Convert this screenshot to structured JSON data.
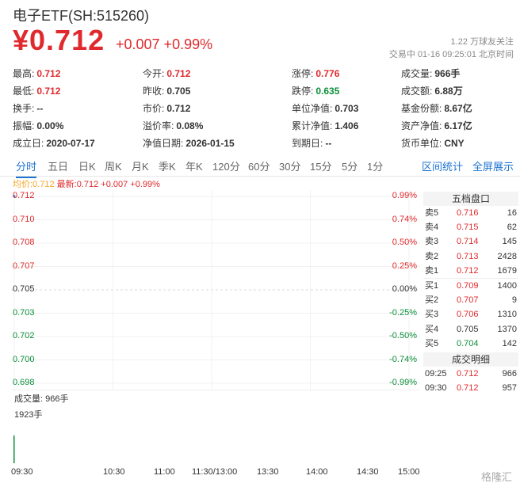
{
  "header": {
    "title": "电子ETF(SH:515260)",
    "price": "¥0.712",
    "change": "+0.007 +0.99%",
    "follow": "1.22 万球友关注",
    "status_time": "交易中 01-16 09:25:01 北京时间"
  },
  "stats": [
    [
      {
        "k": "最高:",
        "v": "0.712",
        "c": "red"
      },
      {
        "k": "今开:",
        "v": "0.712",
        "c": "red"
      },
      {
        "k": "涨停:",
        "v": "0.776",
        "c": "red"
      },
      {
        "k": "成交量:",
        "v": "966手",
        "c": ""
      }
    ],
    [
      {
        "k": "最低:",
        "v": "0.712",
        "c": "red"
      },
      {
        "k": "昨收:",
        "v": "0.705",
        "c": ""
      },
      {
        "k": "跌停:",
        "v": "0.635",
        "c": "green"
      },
      {
        "k": "成交额:",
        "v": "6.88万",
        "c": ""
      }
    ],
    [
      {
        "k": "换手:",
        "v": "--",
        "c": ""
      },
      {
        "k": "市价:",
        "v": "0.712",
        "c": ""
      },
      {
        "k": "单位净值:",
        "v": "0.703",
        "c": ""
      },
      {
        "k": "基金份额:",
        "v": "8.67亿",
        "c": ""
      }
    ],
    [
      {
        "k": "振幅:",
        "v": "0.00%",
        "c": ""
      },
      {
        "k": "溢价率:",
        "v": "0.08%",
        "c": ""
      },
      {
        "k": "累计净值:",
        "v": "1.406",
        "c": ""
      },
      {
        "k": "资产净值:",
        "v": "6.17亿",
        "c": ""
      }
    ],
    [
      {
        "k": "成立日:",
        "v": "2020-07-17",
        "c": ""
      },
      {
        "k": "净值日期:",
        "v": "2026-01-15",
        "c": ""
      },
      {
        "k": "到期日:",
        "v": "--",
        "c": ""
      },
      {
        "k": "货币单位:",
        "v": "CNY",
        "c": ""
      }
    ]
  ],
  "tabs": [
    "分时",
    "五日",
    "日K",
    "周K",
    "月K",
    "季K",
    "年K",
    "120分",
    "60分",
    "30分",
    "15分",
    "5分",
    "1分"
  ],
  "active_tab": "分时",
  "tools": {
    "interval_stats": "区间统计",
    "fullscreen": "全屏展示"
  },
  "legend": {
    "avg": "均价:0.712",
    "last": "最新:0.712 +0.007 +0.99%"
  },
  "chart_data": {
    "type": "line",
    "price_ticks": [
      "0.712",
      "0.710",
      "0.708",
      "0.707",
      "0.705",
      "0.703",
      "0.702",
      "0.700",
      "0.698"
    ],
    "pct_ticks": [
      "0.99%",
      "0.74%",
      "0.50%",
      "0.25%",
      "0.00%",
      "-0.25%",
      "-0.50%",
      "-0.74%",
      "-0.99%"
    ],
    "tick_colors": [
      "red",
      "red",
      "red",
      "red",
      "neutral",
      "green",
      "green",
      "green",
      "green"
    ],
    "ylim": [
      0.698,
      0.712
    ],
    "x_ticks": [
      "09:30",
      "10:30",
      "11:00",
      "11:30/13:00",
      "13:30",
      "14:00",
      "14:30",
      "15:00"
    ],
    "volume_label": "成交量: 966手",
    "volume_max": "1923手",
    "volume_bars": [
      {
        "time": "09:30",
        "value": 966
      }
    ]
  },
  "order_book": {
    "title": "五档盘口",
    "asks": [
      {
        "label": "卖5",
        "price": "0.716",
        "vol": "16",
        "c": "red"
      },
      {
        "label": "卖4",
        "price": "0.715",
        "vol": "62",
        "c": "red"
      },
      {
        "label": "卖3",
        "price": "0.714",
        "vol": "145",
        "c": "red"
      },
      {
        "label": "卖2",
        "price": "0.713",
        "vol": "2428",
        "c": "red"
      },
      {
        "label": "卖1",
        "price": "0.712",
        "vol": "1679",
        "c": "red"
      }
    ],
    "bids": [
      {
        "label": "买1",
        "price": "0.709",
        "vol": "1400",
        "c": "red"
      },
      {
        "label": "买2",
        "price": "0.707",
        "vol": "9",
        "c": "red"
      },
      {
        "label": "买3",
        "price": "0.706",
        "vol": "1310",
        "c": "red"
      },
      {
        "label": "买4",
        "price": "0.705",
        "vol": "1370",
        "c": ""
      },
      {
        "label": "买5",
        "price": "0.704",
        "vol": "142",
        "c": "green"
      }
    ],
    "deals_title": "成交明细",
    "deals": [
      {
        "time": "09:25",
        "price": "0.712",
        "vol": "966"
      },
      {
        "time": "09:30",
        "price": "0.712",
        "vol": "957"
      }
    ]
  },
  "watermark": "格隆汇"
}
